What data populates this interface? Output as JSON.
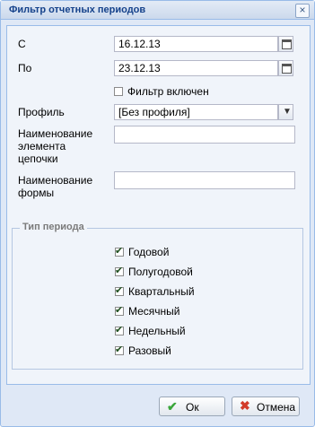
{
  "window": {
    "title": "Фильтр отчетных периодов",
    "close_glyph": "×"
  },
  "form": {
    "from_label": "С",
    "from_value": "16.12.13",
    "to_label": "По",
    "to_value": "23.12.13",
    "filter_enabled_label": "Фильтр включен",
    "filter_enabled": false,
    "profile_label": "Профиль",
    "profile_value": "[Без профиля]",
    "chain_element_label_line1": "Наименование",
    "chain_element_label_line2": "элемента",
    "chain_element_label_line3": "цепочки",
    "chain_element_value": "",
    "form_name_label_line1": "Наименование",
    "form_name_label_line2": "формы",
    "form_name_value": ""
  },
  "period_type": {
    "legend": "Тип периода",
    "options": [
      {
        "label": "Годовой",
        "checked": true
      },
      {
        "label": "Полугодовой",
        "checked": true
      },
      {
        "label": "Квартальный",
        "checked": true
      },
      {
        "label": "Месячный",
        "checked": true
      },
      {
        "label": "Недельный",
        "checked": true
      },
      {
        "label": "Разовый",
        "checked": true
      }
    ]
  },
  "buttons": {
    "ok": "Ок",
    "cancel": "Отмена"
  },
  "icons": {
    "close": "close-icon",
    "calendar": "calendar-icon",
    "dropdown": "chevron-down-icon",
    "ok": "checkmark-icon",
    "cancel": "x-icon"
  },
  "colors": {
    "title_text": "#15428b",
    "border": "#99bbe8",
    "window_bg": "#dfe8f6",
    "ok_icon": "#3aa63a",
    "cancel_icon": "#d23b2a"
  }
}
